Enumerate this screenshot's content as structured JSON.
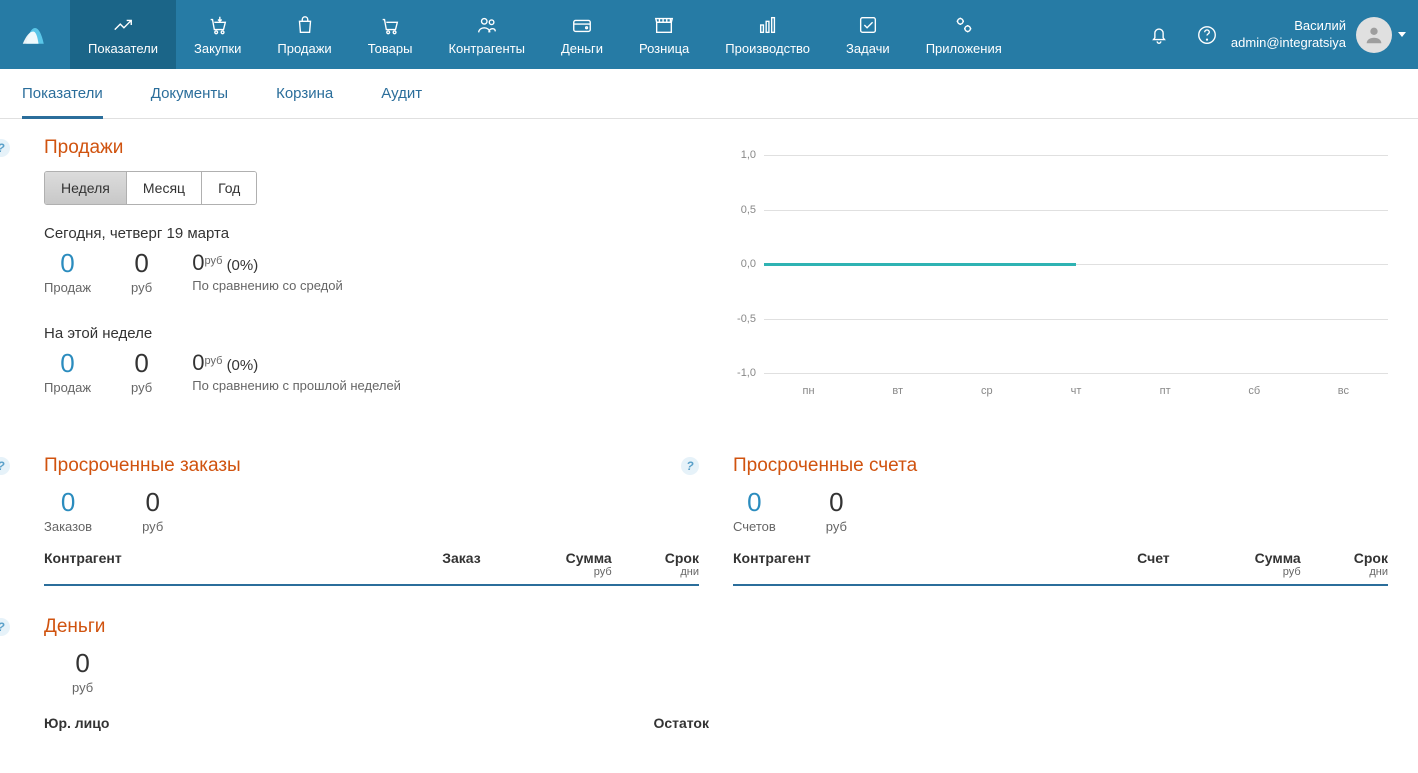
{
  "topnav": {
    "items": [
      {
        "label": "Показатели"
      },
      {
        "label": "Закупки"
      },
      {
        "label": "Продажи"
      },
      {
        "label": "Товары"
      },
      {
        "label": "Контрагенты"
      },
      {
        "label": "Деньги"
      },
      {
        "label": "Розница"
      },
      {
        "label": "Производство"
      },
      {
        "label": "Задачи"
      },
      {
        "label": "Приложения"
      }
    ]
  },
  "user": {
    "name": "Василий",
    "email": "admin@integratsiya"
  },
  "subnav": {
    "items": [
      {
        "label": "Показатели"
      },
      {
        "label": "Документы"
      },
      {
        "label": "Корзина"
      },
      {
        "label": "Аудит"
      }
    ]
  },
  "sales": {
    "title": "Продажи",
    "periods": [
      {
        "label": "Неделя"
      },
      {
        "label": "Месяц"
      },
      {
        "label": "Год"
      }
    ],
    "today": {
      "date_line": "Сегодня, четверг 19 марта",
      "count": "0",
      "count_label": "Продаж",
      "amount": "0",
      "amount_label": "руб",
      "compare_value": "0",
      "compare_rub": "руб",
      "compare_pct": "(0%)",
      "compare_sub": "По сравнению со средой"
    },
    "week": {
      "date_line": "На этой неделе",
      "count": "0",
      "count_label": "Продаж",
      "amount": "0",
      "amount_label": "руб",
      "compare_value": "0",
      "compare_rub": "руб",
      "compare_pct": "(0%)",
      "compare_sub": "По сравнению с прошлой неделей"
    }
  },
  "chart_data": {
    "type": "line",
    "x": [
      "пн",
      "вт",
      "ср",
      "чт",
      "пт",
      "сб",
      "вс"
    ],
    "series": [
      {
        "name": "sales",
        "values": [
          0,
          0,
          0,
          0,
          null,
          null,
          null
        ]
      }
    ],
    "ylim": [
      -1.0,
      1.0
    ],
    "yticks": [
      "1,0",
      "0,5",
      "0,0",
      "-0,5",
      "-1,0"
    ],
    "title": "",
    "xlabel": "",
    "ylabel": ""
  },
  "overdue_orders": {
    "title": "Просроченные заказы",
    "count": "0",
    "count_label": "Заказов",
    "amount": "0",
    "amount_label": "руб",
    "cols": {
      "c1": "Контрагент",
      "c2": "Заказ",
      "c3": "Сумма",
      "c3sub": "руб",
      "c4": "Срок",
      "c4sub": "дни"
    }
  },
  "overdue_invoices": {
    "title": "Просроченные счета",
    "count": "0",
    "count_label": "Счетов",
    "amount": "0",
    "amount_label": "руб",
    "cols": {
      "c1": "Контрагент",
      "c2": "Счет",
      "c3": "Сумма",
      "c3sub": "руб",
      "c4": "Срок",
      "c4sub": "дни"
    }
  },
  "money": {
    "title": "Деньги",
    "amount": "0",
    "amount_label": "руб",
    "cols": {
      "c1": "Юр. лицо",
      "c2": "Остаток"
    }
  }
}
